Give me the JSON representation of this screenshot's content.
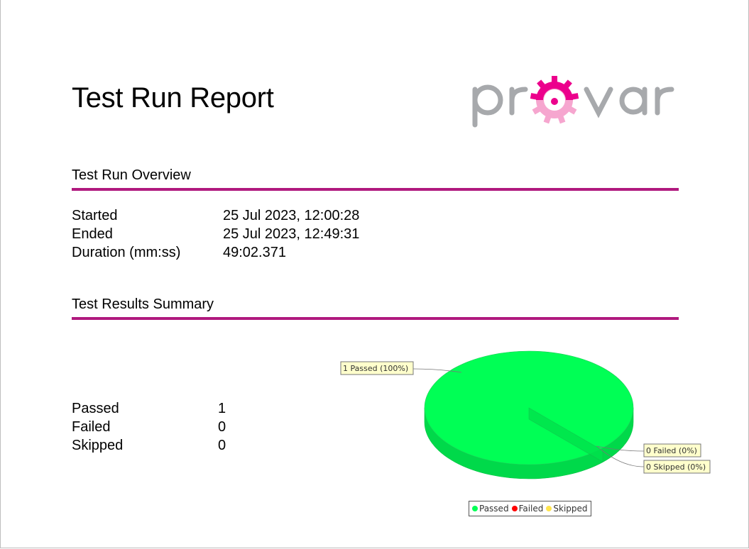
{
  "report": {
    "title": "Test Run Report",
    "logo_text": "provar"
  },
  "overview": {
    "heading": "Test Run Overview",
    "rows": [
      {
        "label": "Started",
        "value": "25 Jul 2023, 12:00:28"
      },
      {
        "label": "Ended",
        "value": "25 Jul 2023, 12:49:31"
      },
      {
        "label": "Duration (mm:ss)",
        "value": "49:02.371"
      }
    ]
  },
  "summary": {
    "heading": "Test Results Summary",
    "rows": [
      {
        "label": "Passed",
        "value": "1"
      },
      {
        "label": "Failed",
        "value": "0"
      },
      {
        "label": "Skipped",
        "value": "0"
      }
    ]
  },
  "colors": {
    "accent": "#b0197e",
    "logo_pink": "#ec008c",
    "logo_gray": "#a7a9ac",
    "passed": "#00ff55",
    "failed": "#ff0000",
    "skipped": "#ffe44d"
  },
  "chart_data": {
    "type": "pie",
    "title": "",
    "categories": [
      "Passed",
      "Failed",
      "Skipped"
    ],
    "values": [
      1,
      0,
      0
    ],
    "labels": [
      "1 Passed (100%)",
      "0 Failed (0%)",
      "0 Skipped (0%)"
    ],
    "legend": {
      "position": "bottom",
      "entries": [
        "Passed",
        "Failed",
        "Skipped"
      ]
    },
    "style": "3d"
  }
}
